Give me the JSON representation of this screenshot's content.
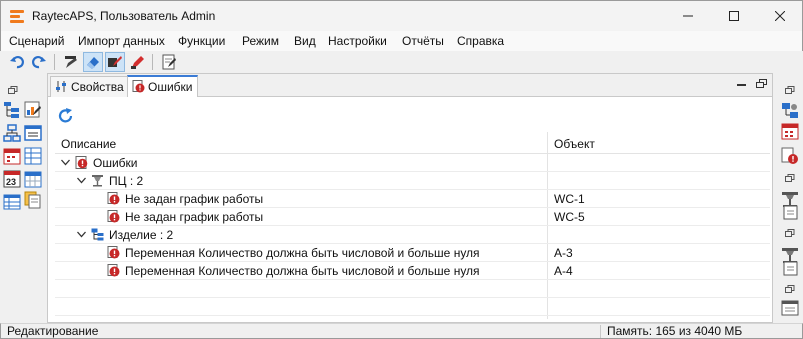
{
  "window": {
    "title": "RaytecAPS, Пользователь Admin",
    "minimize_icon": "minimize-icon",
    "maximize_icon": "maximize-icon",
    "close_icon": "close-icon"
  },
  "menu": [
    "Сценарий",
    "Импорт данных",
    "Функции",
    "Режим",
    "Вид",
    "Настройки",
    "Отчёты",
    "Справка"
  ],
  "toolbar": {
    "buttons": [
      "undo-icon",
      "redo-icon",
      "edit-pencil-icon",
      "eraser-icon",
      "edit-mode-icon",
      "marker-icon",
      "document-edit-icon"
    ]
  },
  "tabs": [
    {
      "label": "Свойства",
      "icon": "properties-icon",
      "active": false
    },
    {
      "label": "Ошибки",
      "icon": "error-document-icon",
      "active": true
    }
  ],
  "grid": {
    "columns": [
      "Описание",
      "Объект"
    ],
    "rows": [
      {
        "level": 0,
        "expander": true,
        "icon": "error-document-icon",
        "text": "Ошибки",
        "object": ""
      },
      {
        "level": 1,
        "expander": true,
        "icon": "workcenter-icon",
        "text": "ПЦ : 2",
        "object": ""
      },
      {
        "level": 2,
        "expander": false,
        "icon": "error-icon",
        "text": "Не задан график работы",
        "object": "WC-1"
      },
      {
        "level": 2,
        "expander": false,
        "icon": "error-icon",
        "text": "Не задан график работы",
        "object": "WC-5"
      },
      {
        "level": 1,
        "expander": true,
        "icon": "product-tree-icon",
        "text": "Изделие : 2",
        "object": ""
      },
      {
        "level": 2,
        "expander": false,
        "icon": "error-icon",
        "text": "Переменная Количество должна быть числовой и больше нуля",
        "object": "A-3"
      },
      {
        "level": 2,
        "expander": false,
        "icon": "error-icon",
        "text": "Переменная Количество должна быть числовой и больше нуля",
        "object": "A-4"
      },
      {
        "level": 0,
        "expander": false,
        "icon": "",
        "text": "",
        "object": ""
      },
      {
        "level": 0,
        "expander": false,
        "icon": "",
        "text": "",
        "object": ""
      }
    ]
  },
  "status": {
    "mode": "Редактирование",
    "memory": "Память: 165 из 4040 МБ"
  },
  "colors": {
    "accent": "#3a7bd5",
    "error": "#c62828",
    "app_orange": "#f07a1c"
  }
}
